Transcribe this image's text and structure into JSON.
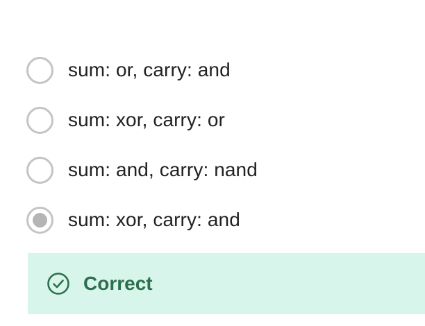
{
  "options": [
    {
      "label": "sum: or, carry: and",
      "selected": false
    },
    {
      "label": "sum: xor, carry: or",
      "selected": false
    },
    {
      "label": "sum: and, carry: nand",
      "selected": false
    },
    {
      "label": "sum: xor, carry: and",
      "selected": true
    }
  ],
  "feedback": {
    "text": "Correct",
    "icon": "check-circle-icon",
    "background_color": "#d7f5ea",
    "text_color": "#2e6e4e"
  },
  "colors": {
    "radio_border": "#c4c4c4",
    "radio_selected_dot": "#b5b5b5",
    "option_text": "#222222"
  }
}
